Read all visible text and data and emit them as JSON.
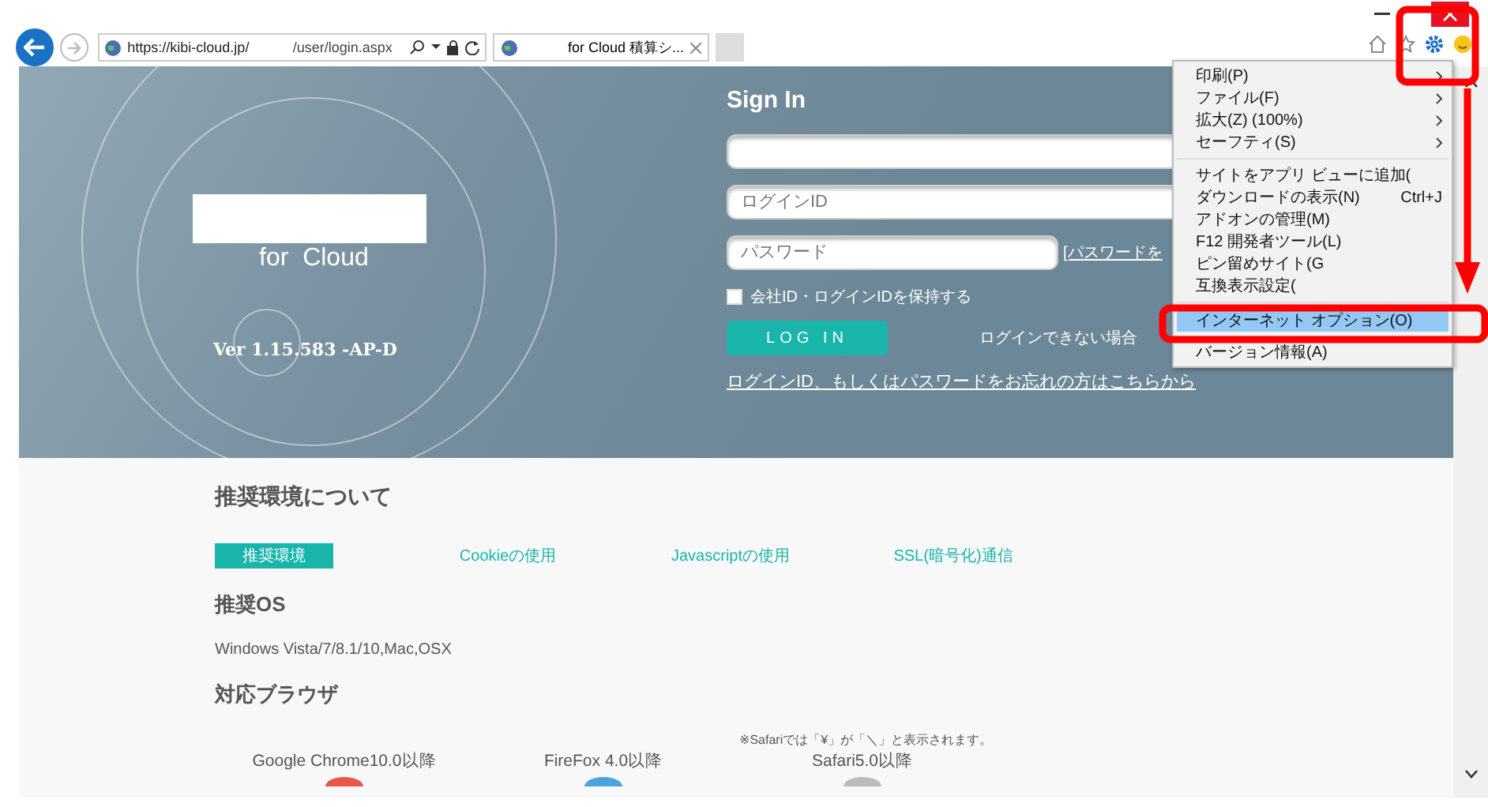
{
  "browser": {
    "address": {
      "host": "https://kibi-cloud.jp/",
      "path": "/user/login.aspx"
    },
    "tab": {
      "title": "for Cloud 積算シ..."
    }
  },
  "hero": {
    "product": "for  Cloud",
    "version": "Ver 1.15.583 -AP-D"
  },
  "signin": {
    "title": "Sign In",
    "login_id": {
      "placeholder": "ログインID"
    },
    "password": {
      "placeholder": "パスワード"
    },
    "password_link": "[パスワードを",
    "remember": {
      "label": "会社ID・ログインIDを保持する",
      "checked": false
    },
    "login_button": "LOG IN",
    "trouble": "ログインできない場合",
    "forgot_link": "ログインID、もしくはパスワードをお忘れの方はこちらから"
  },
  "menu": {
    "groups": [
      [
        {
          "label": "印刷(P)",
          "submenu": true,
          "selected": false
        },
        {
          "label": "ファイル(F)",
          "submenu": true,
          "selected": false
        },
        {
          "label": "拡大(Z) (100%)",
          "submenu": true,
          "selected": false
        },
        {
          "label": "セーフティ(S)",
          "submenu": true,
          "selected": false
        }
      ],
      [
        {
          "label": "サイトをアプリ ビューに追加(",
          "submenu": false,
          "selected": false
        },
        {
          "label": "ダウンロードの表示(N)",
          "shortcut": "Ctrl+J",
          "submenu": false,
          "selected": false
        },
        {
          "label": "アドオンの管理(M)",
          "submenu": false,
          "selected": false
        },
        {
          "label": "F12 開発者ツール(L)",
          "submenu": false,
          "selected": false
        },
        {
          "label": "ピン留めサイト(G",
          "submenu": false,
          "selected": false
        },
        {
          "label": "互換表示設定(",
          "submenu": false,
          "selected": false
        }
      ],
      [
        {
          "label": "インターネット オプション(O)",
          "submenu": false,
          "selected": true
        },
        {
          "label": "バージョン情報(A)",
          "submenu": false,
          "selected": false
        }
      ]
    ]
  },
  "env": {
    "title": "推奨環境について",
    "tabs": [
      {
        "label": "推奨環境",
        "selected": true
      },
      {
        "label": "Cookieの使用",
        "selected": false
      },
      {
        "label": "Javascriptの使用",
        "selected": false
      },
      {
        "label": "SSL(暗号化)通信",
        "selected": false
      }
    ],
    "os_heading": "推奨OS",
    "os_text": "Windows Vista/7/8.1/10,Mac,OSX",
    "browser_heading": "対応ブラウザ",
    "safari_note": "※Safariでは「¥」が「＼」と表示されます。",
    "browsers": [
      {
        "name": "Google Chrome10.0以降",
        "color": "#e8574a"
      },
      {
        "name": "FireFox 4.0以降",
        "color": "#4aa3df"
      },
      {
        "name": "Safari5.0以降",
        "color": "#bbbbbb"
      }
    ]
  }
}
